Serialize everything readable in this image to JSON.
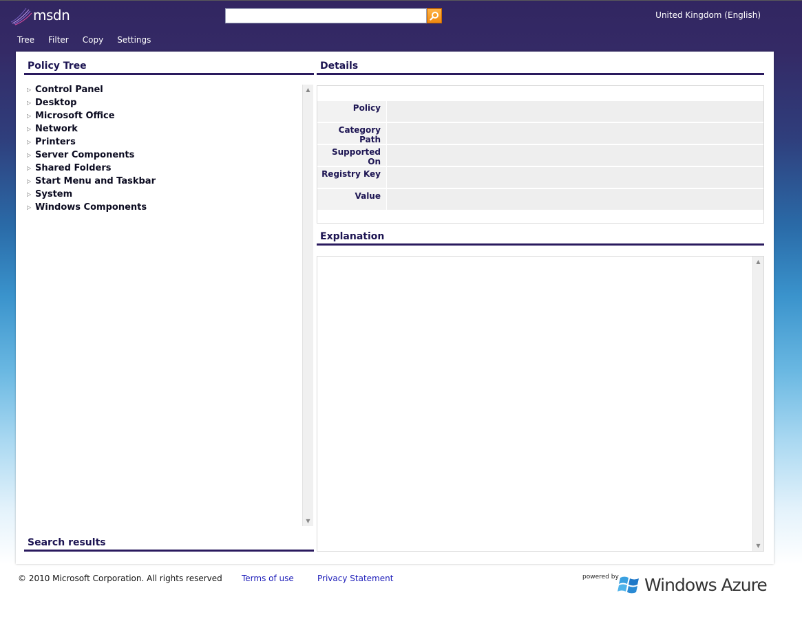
{
  "header": {
    "logo_text": "msdn",
    "search": {
      "value": "",
      "placeholder": ""
    },
    "locale": "United Kingdom (English)"
  },
  "menu": {
    "items": [
      {
        "label": "Tree"
      },
      {
        "label": "Filter"
      },
      {
        "label": "Copy"
      },
      {
        "label": "Settings"
      }
    ]
  },
  "policy_tree": {
    "title": "Policy Tree",
    "items": [
      {
        "label": "Control Panel"
      },
      {
        "label": "Desktop"
      },
      {
        "label": "Microsoft Office"
      },
      {
        "label": "Network"
      },
      {
        "label": "Printers"
      },
      {
        "label": "Server Components"
      },
      {
        "label": "Shared Folders"
      },
      {
        "label": "Start Menu and Taskbar"
      },
      {
        "label": "System"
      },
      {
        "label": "Windows Components"
      }
    ]
  },
  "search_results": {
    "title": "Search results"
  },
  "details": {
    "title": "Details",
    "rows": [
      {
        "label": "Policy",
        "value": ""
      },
      {
        "label": "Category Path",
        "value": ""
      },
      {
        "label": "Supported On",
        "value": ""
      },
      {
        "label": "Registry Key",
        "value": ""
      },
      {
        "label": "Value",
        "value": ""
      }
    ]
  },
  "explanation": {
    "title": "Explanation",
    "text": ""
  },
  "footer": {
    "copyright": "© 2010 Microsoft Corporation. All rights reserved",
    "terms": "Terms of use",
    "privacy": "Privacy Statement",
    "powered_by": "powered by",
    "brand": "Windows Azure"
  },
  "colors": {
    "header_bg": "#322661",
    "title_underline": "#2a1a5e",
    "title_text": "#1c1452",
    "link": "#1a1ab8",
    "search_button": "#f08a10"
  },
  "icons": {
    "logo": "msdn-logo",
    "search": "search-icon",
    "tree_expand": "triangle-right-icon",
    "azure": "windows-flag-icon"
  }
}
